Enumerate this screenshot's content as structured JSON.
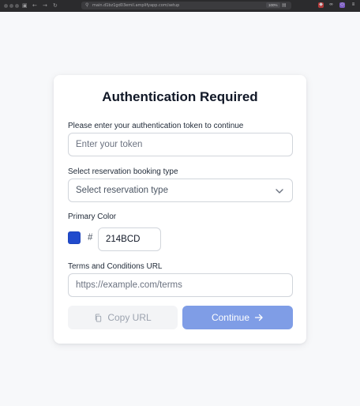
{
  "browser": {
    "url": "main.d1bz1gd03emil.amplifyapp.com/setup",
    "zoom": "100%"
  },
  "card": {
    "title": "Authentication Required",
    "token": {
      "label": "Please enter your authentication token to continue",
      "placeholder": "Enter your token",
      "value": ""
    },
    "booking_type": {
      "label": "Select reservation booking type",
      "selected": "Select reservation type"
    },
    "primary_color": {
      "label": "Primary Color",
      "hash": "#",
      "hex": "214BCD",
      "swatch_color": "#214BCD"
    },
    "terms": {
      "label": "Terms and Conditions URL",
      "placeholder": "https://example.com/terms",
      "value": ""
    },
    "buttons": {
      "copy_label": "Copy URL",
      "continue_label": "Continue"
    }
  },
  "colors": {
    "page_background": "#f7f8fa",
    "continue_button": "#7f9de6",
    "copy_button": "#f3f4f6"
  },
  "icons": {
    "copy": "copy-icon",
    "continue": "arrow-right-icon",
    "select": "chevron-down-icon"
  }
}
